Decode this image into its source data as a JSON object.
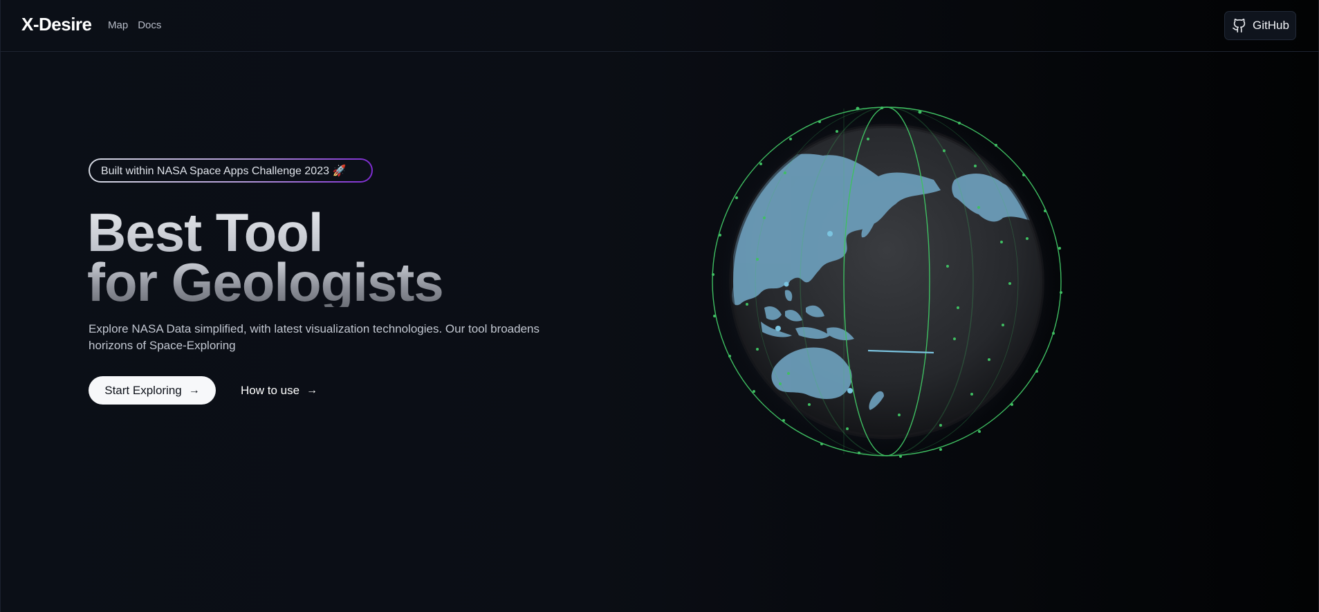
{
  "header": {
    "brand": "X-Desire",
    "nav": [
      {
        "label": "Map"
      },
      {
        "label": "Docs"
      }
    ],
    "github_label": "GitHub",
    "github_icon": "github-icon"
  },
  "hero": {
    "badge": "Built within NASA Space Apps Challenge 2023 🚀",
    "headline_line1": "Best Tool",
    "headline_line2": "for Geologists",
    "description": "Explore NASA Data simplified, with latest visualization technologies. Our tool broadens horizons of Space-Exploring",
    "primary_button": "Start Exploring",
    "secondary_button": "How to use",
    "arrow_icon": "arrow-right-icon"
  },
  "globe": {
    "icon": "globe-icon",
    "land_color": "#6b9cb8",
    "ring_color": "#3fbf62",
    "sphere_color": "#2a2c30"
  }
}
